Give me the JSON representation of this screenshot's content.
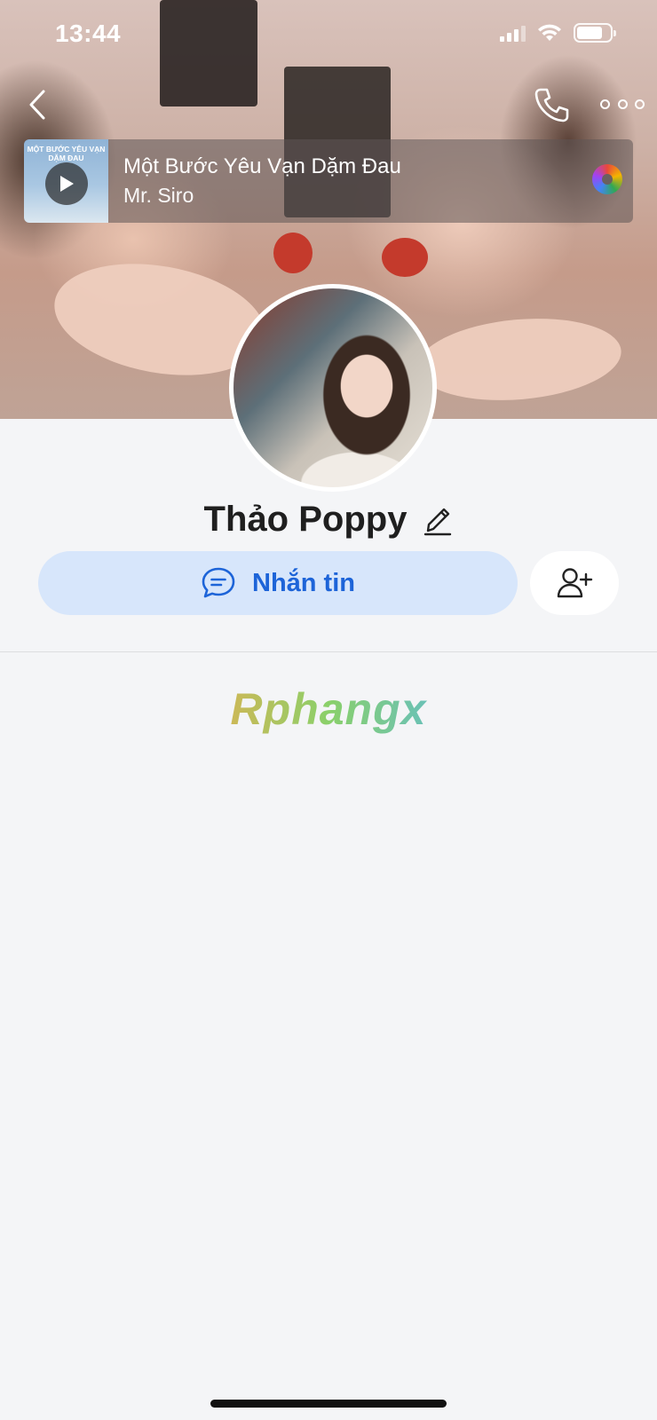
{
  "status_bar": {
    "time": "13:44"
  },
  "music": {
    "album_text": "MỘT BƯỚC YÊU VẠN DẶM ĐAU",
    "title": "Một Bước Yêu Vạn Dặm Đau",
    "artist": "Mr. Siro"
  },
  "profile": {
    "name": "Thảo Poppy"
  },
  "actions": {
    "message_label": "Nhắn tin"
  },
  "watermark": {
    "text": "Rphangx"
  },
  "colors": {
    "accent": "#1d64d8",
    "message_bg": "#d7e6fb",
    "page_bg": "#f4f5f7"
  },
  "icons": {
    "back": "chevron-left-icon",
    "call": "phone-icon",
    "more": "more-dots-icon",
    "play": "play-icon",
    "disc": "music-disc-icon",
    "edit": "pencil-icon",
    "message": "chat-bubble-icon",
    "add_friend": "add-user-icon"
  }
}
